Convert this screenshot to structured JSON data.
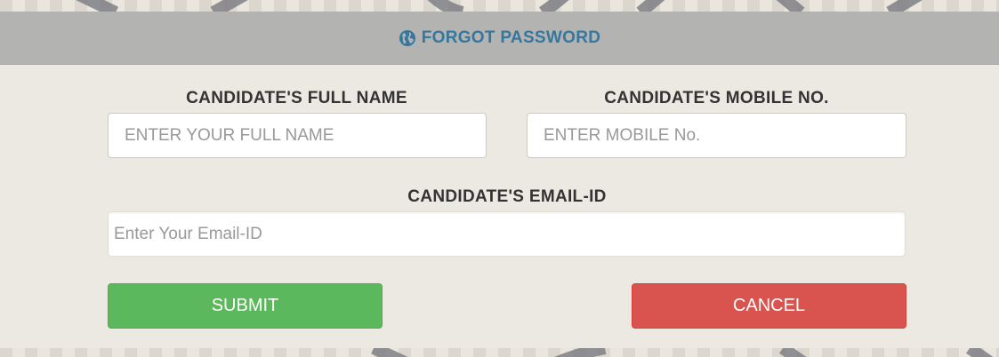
{
  "dialog": {
    "title": "FORGOT PASSWORD",
    "title_icon": "globe-icon"
  },
  "form": {
    "full_name": {
      "label": "CANDIDATE'S FULL NAME",
      "placeholder": "ENTER YOUR FULL NAME",
      "value": ""
    },
    "mobile": {
      "label": "CANDIDATE'S MOBILE NO.",
      "placeholder": "ENTER MOBILE No.",
      "value": ""
    },
    "email": {
      "label": "CANDIDATE'S EMAIL-ID",
      "placeholder": "Enter Your Email-ID",
      "value": ""
    }
  },
  "actions": {
    "submit_label": "SUBMIT",
    "cancel_label": "CANCEL"
  },
  "colors": {
    "header_bg": "#b3b3b1",
    "title": "#35779f",
    "submit": "#5cb85c",
    "cancel": "#d9534f",
    "panel_bg": "#ece8e2"
  }
}
